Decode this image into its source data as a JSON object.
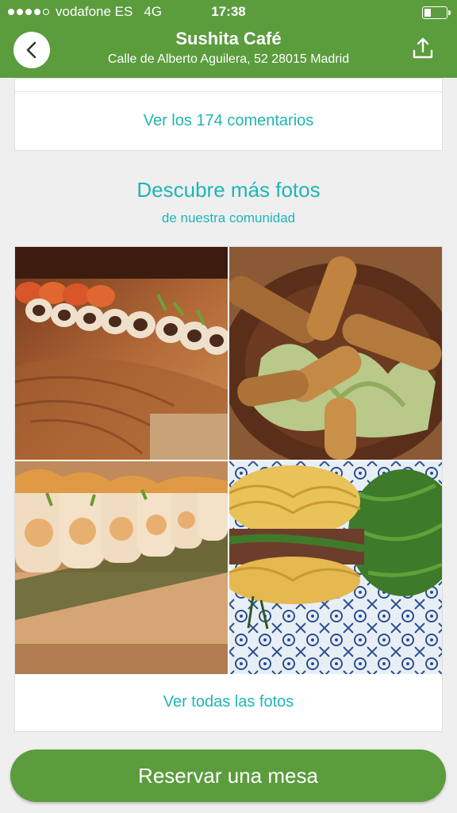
{
  "status_bar": {
    "carrier": "vodafone ES",
    "network": "4G",
    "time": "17:38",
    "signal_icon": "signal-dots-icon",
    "battery_icon": "battery-icon"
  },
  "header": {
    "title": "Sushita Café",
    "subtitle": "Calle de Alberto Aguilera, 52 28015 Madrid",
    "back_icon": "chevron-left-icon",
    "share_icon": "share-icon"
  },
  "reviews": {
    "link_label": "Ver los 174 comentarios"
  },
  "photos_section": {
    "title": "Descubre más fotos",
    "subtitle": "de nuestra comunidad",
    "photos": [
      "sushi-rolls-photo",
      "spring-rolls-photo",
      "shrimp-tempura-rolls-photo",
      "noodle-burger-photo"
    ],
    "view_all_label": "Ver todas las fotos"
  },
  "footer": {
    "reserve_label": "Reservar una mesa"
  },
  "colors": {
    "brand_green": "#5b9c3d",
    "accent_teal": "#1fb5b5",
    "background": "#efefef"
  }
}
